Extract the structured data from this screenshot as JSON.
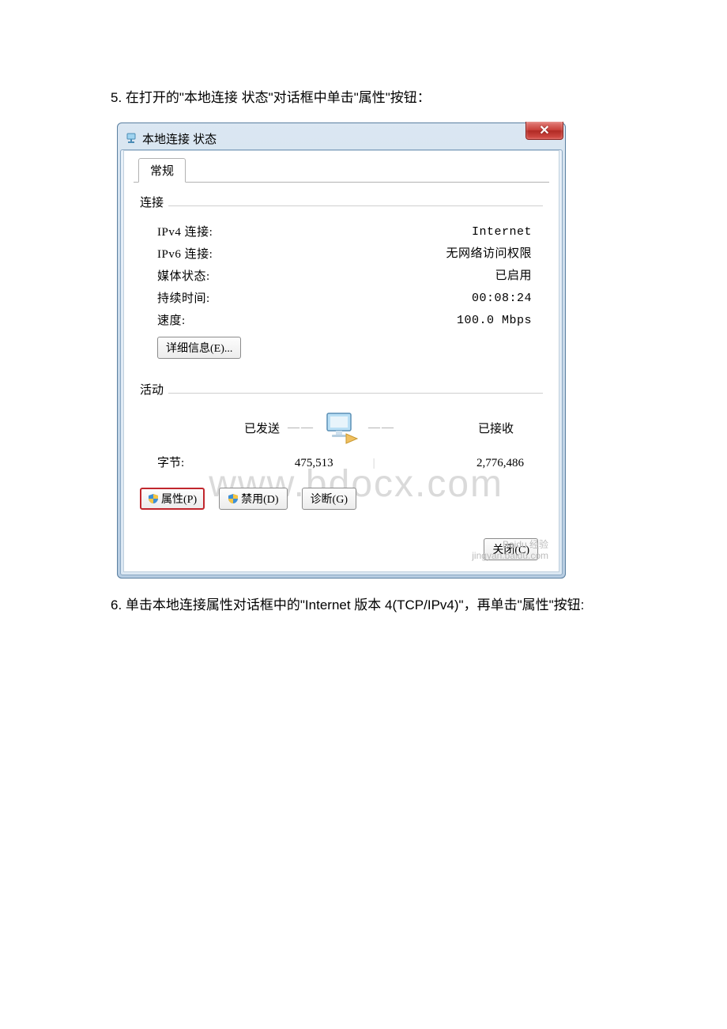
{
  "step5_text": "5. 在打开的\"本地连接 状态\"对话框中单击\"属性\"按钮：",
  "step6_text": "6. 单击本地连接属性对话框中的\"Internet 版本 4(TCP/IPv4)\"，再单击\"属性\"按钮:",
  "dialog": {
    "title": "本地连接 状态",
    "tab_general": "常规",
    "group_connection": "连接",
    "rows": {
      "ipv4_label": "IPv4 连接:",
      "ipv4_value": "Internet",
      "ipv6_label": "IPv6 连接:",
      "ipv6_value": "无网络访问权限",
      "media_label": "媒体状态:",
      "media_value": "已启用",
      "duration_label": "持续时间:",
      "duration_value": "00:08:24",
      "speed_label": "速度:",
      "speed_value": "100.0 Mbps"
    },
    "details_btn": "详细信息(E)...",
    "group_activity": "活动",
    "activity": {
      "sent_label": "已发送",
      "recv_label": "已接收",
      "bytes_label": "字节:",
      "bytes_sent": "475,513",
      "bytes_recv": "2,776,486"
    },
    "buttons": {
      "properties": "属性(P)",
      "disable": "禁用(D)",
      "diagnose": "诊断(G)",
      "close": "关闭(C)"
    }
  },
  "watermark": "www.bdocx.com",
  "baidu_wm_1": "Baidu 经验",
  "baidu_wm_2": "jingyan.baidu.com"
}
